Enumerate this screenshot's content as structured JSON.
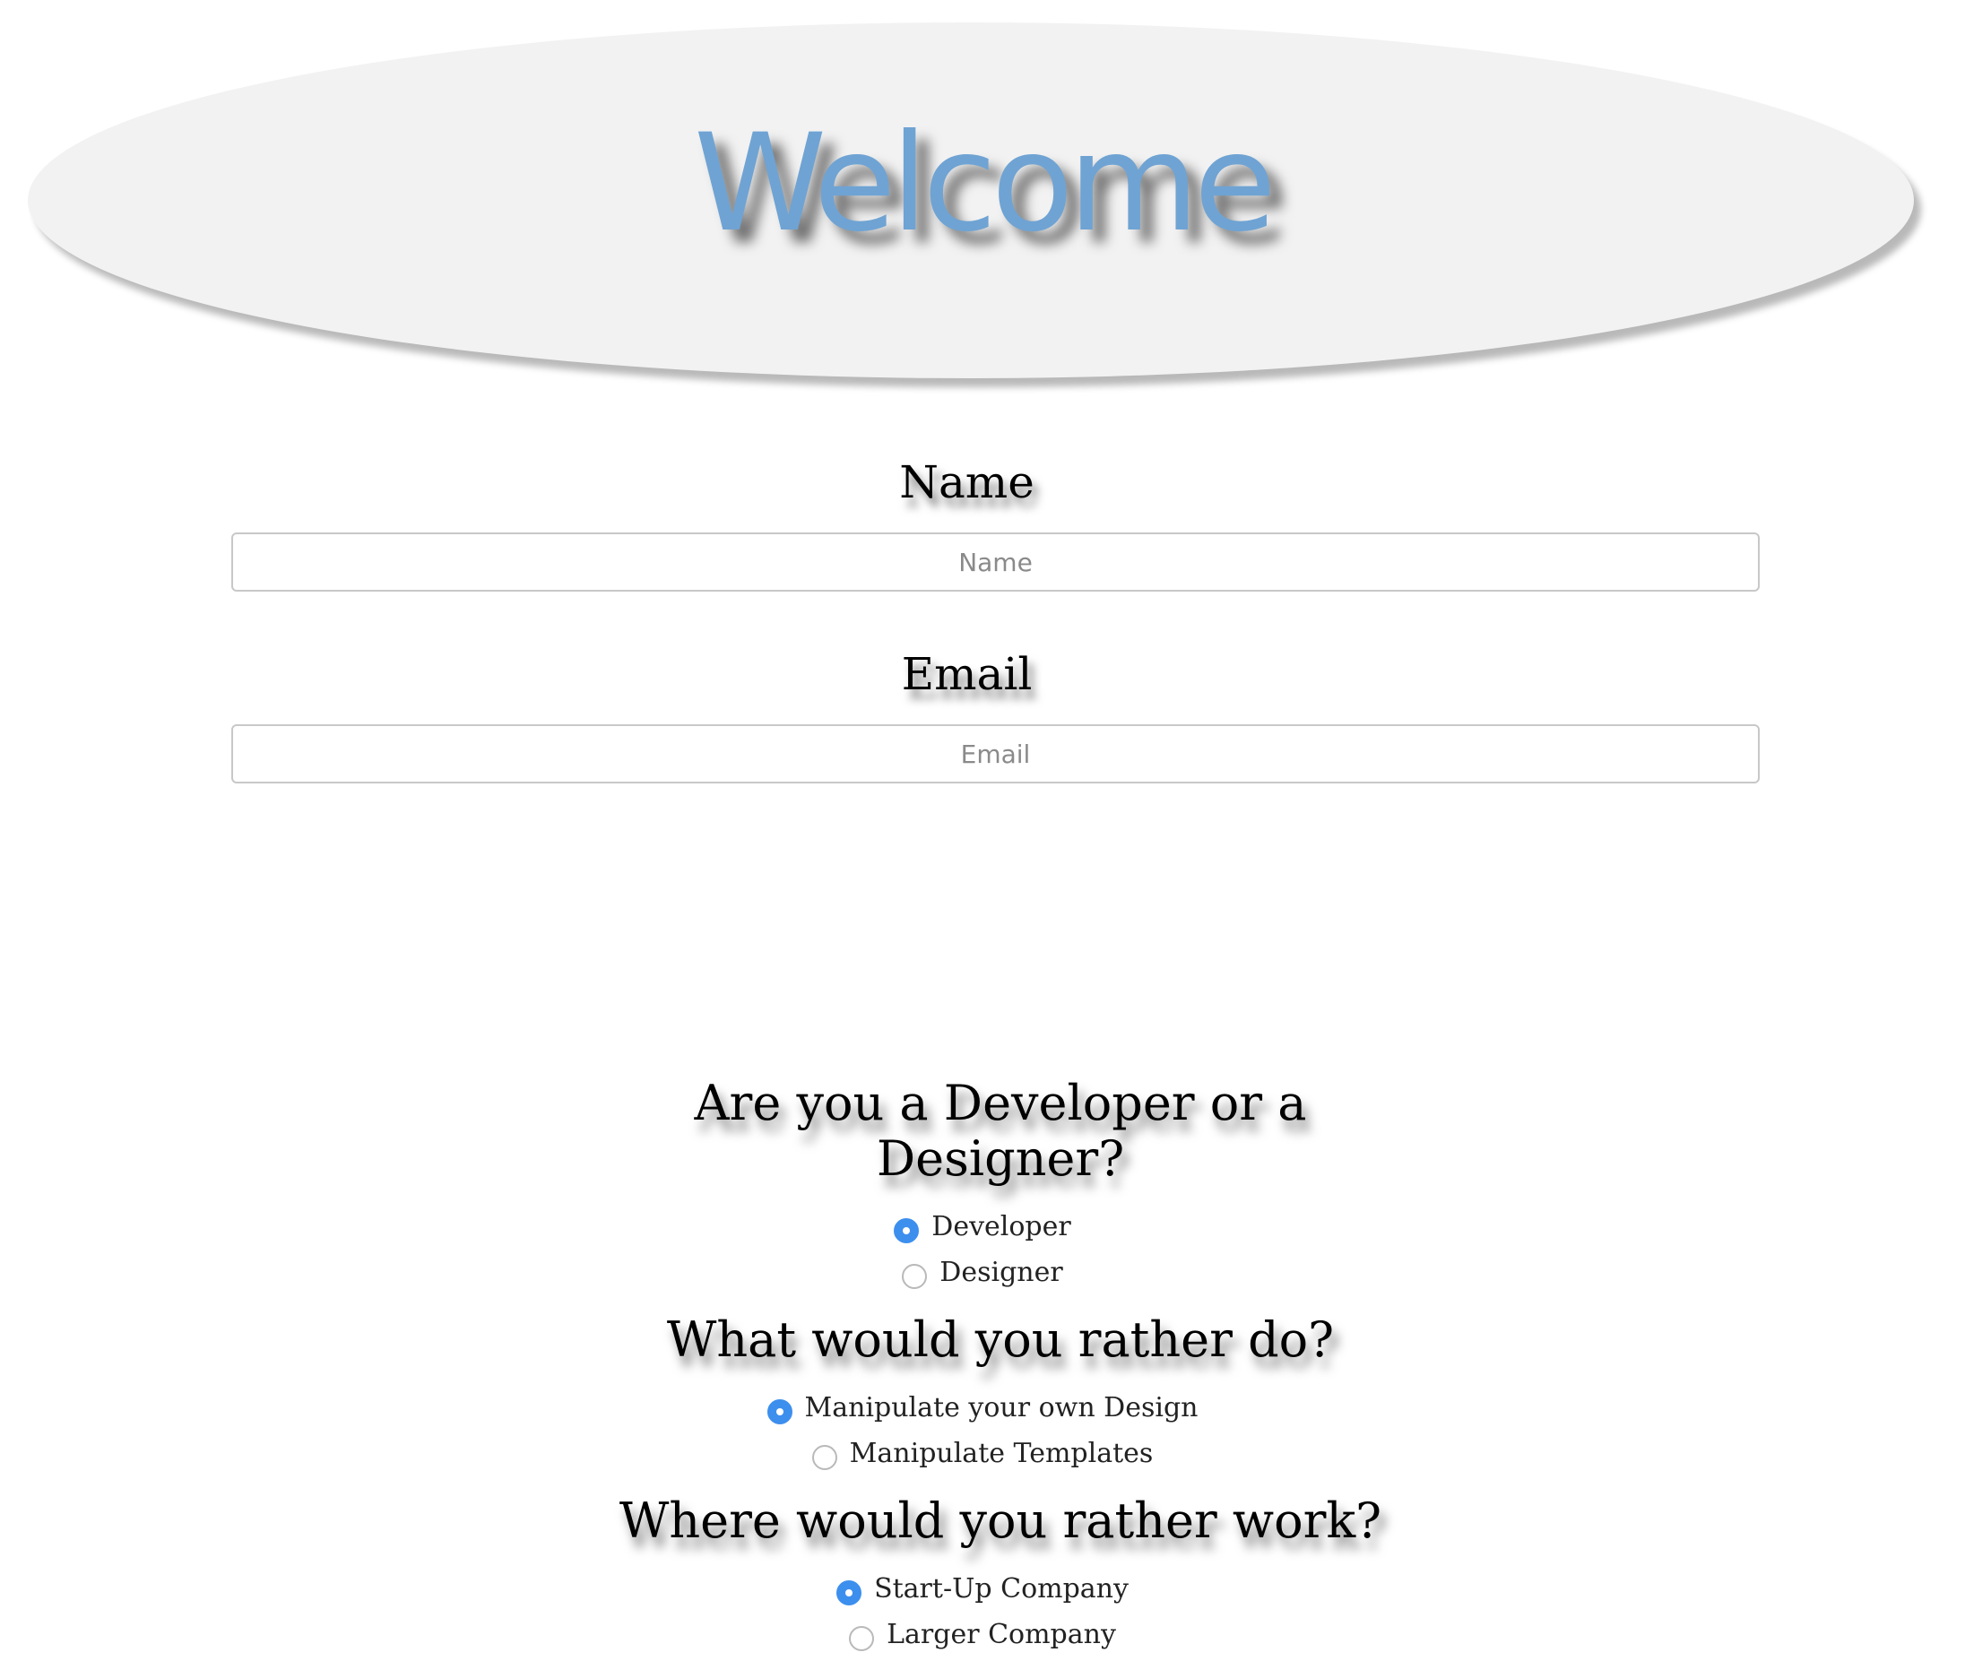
{
  "header": {
    "title": "Welcome"
  },
  "form": {
    "name": {
      "label": "Name",
      "placeholder": "Name",
      "value": ""
    },
    "email": {
      "label": "Email",
      "placeholder": "Email",
      "value": ""
    }
  },
  "questions": [
    {
      "line1": "Are you a Developer or a",
      "line2": "Designer?",
      "options": [
        {
          "label": "Developer",
          "selected": true
        },
        {
          "label": "Designer",
          "selected": false
        }
      ]
    },
    {
      "line1": "What would you rather do?",
      "options": [
        {
          "label": "Manipulate your own Design",
          "selected": true
        },
        {
          "label": "Manipulate Templates",
          "selected": false
        }
      ]
    },
    {
      "line1": "Where would you rather work?",
      "options": [
        {
          "label": "Start-Up Company",
          "selected": true
        },
        {
          "label": "Larger Company",
          "selected": false
        }
      ]
    }
  ],
  "colors": {
    "title": "#6fa3d3",
    "radio_selected": "#3d8fee",
    "hero_background": "#f2f2f2"
  }
}
